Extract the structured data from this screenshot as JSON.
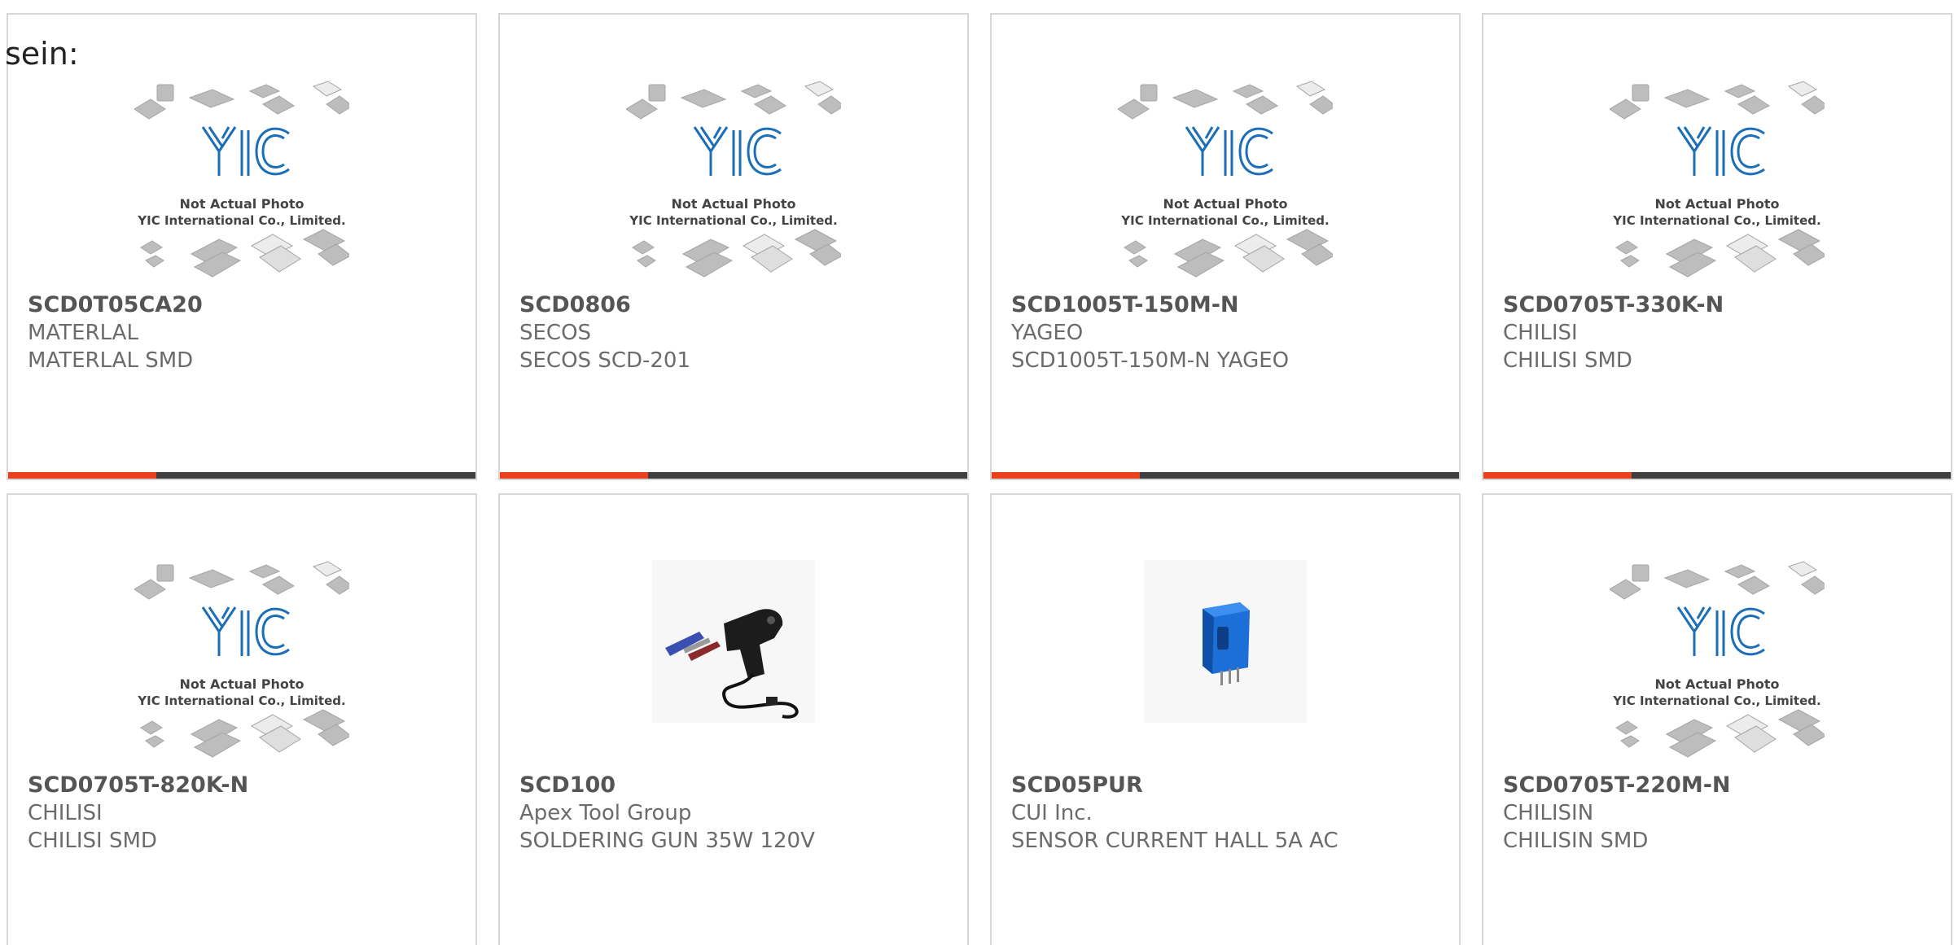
{
  "clipped_text": "sein:",
  "placeholder_image": {
    "line1": "Not Actual Photo",
    "line2": "YIC International Co., Limited.",
    "logo": "YIC"
  },
  "colors": {
    "accent": "#e8411c",
    "bar": "#3f3f3f",
    "logo_blue": "#1b6fb8"
  },
  "products": [
    {
      "part_number": "SCD0T05CA20",
      "manufacturer": "MATERLAL",
      "description": "MATERLAL SMD",
      "image": "yic-placeholder"
    },
    {
      "part_number": "SCD0806",
      "manufacturer": "SECOS",
      "description": "SECOS SCD-201",
      "image": "yic-placeholder"
    },
    {
      "part_number": "SCD1005T-150M-N",
      "manufacturer": "YAGEO",
      "description": "SCD1005T-150M-N YAGEO",
      "image": "yic-placeholder"
    },
    {
      "part_number": "SCD0705T-330K-N",
      "manufacturer": "CHILISI",
      "description": "CHILISI SMD",
      "image": "yic-placeholder"
    },
    {
      "part_number": "SCD0705T-820K-N",
      "manufacturer": "CHILISI",
      "description": "CHILISI SMD",
      "image": "yic-placeholder"
    },
    {
      "part_number": "SCD100",
      "manufacturer": "Apex Tool Group",
      "description": "SOLDERING GUN 35W 120V",
      "image": "soldering-gun-photo"
    },
    {
      "part_number": "SCD05PUR",
      "manufacturer": "CUI Inc.",
      "description": "SENSOR CURRENT HALL 5A AC",
      "image": "current-sensor-photo"
    },
    {
      "part_number": "SCD0705T-220M-N",
      "manufacturer": "CHILISIN",
      "description": "CHILISIN SMD",
      "image": "yic-placeholder"
    }
  ]
}
